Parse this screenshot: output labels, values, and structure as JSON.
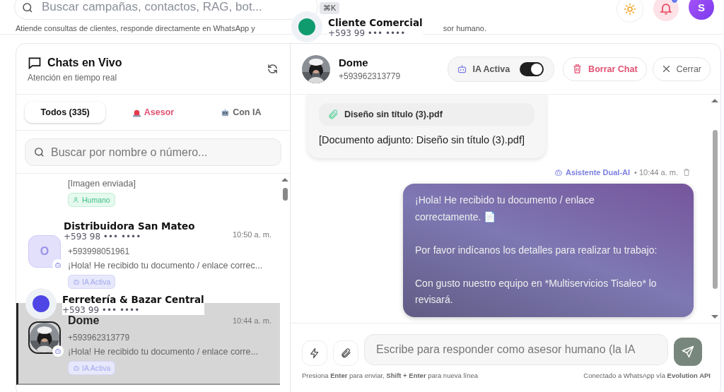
{
  "topbar": {
    "search_placeholder": "Buscar campañas, contactos, RAG, bot...",
    "shortcut": "⌘K",
    "avatar_initial": "S",
    "notifications_unread": true
  },
  "page_subtitle": [
    "Atiende consultas de clientes, responde directamente en WhatsApp y",
    "sor humano."
  ],
  "chats_panel": {
    "title": "Chats en Vivo",
    "subtitle": "Atención en tiempo real",
    "tabs": [
      {
        "label": "Todos (335)",
        "selected": true,
        "kind": "all"
      },
      {
        "label": "Asesor",
        "selected": false,
        "kind": "advisor"
      },
      {
        "label": "Con IA",
        "selected": false,
        "kind": "ai"
      }
    ],
    "search_placeholder": "Buscar por nombre o número...",
    "conversations": [
      {
        "kind": "partial",
        "preview": "[Imagen enviada]",
        "tag": {
          "kind": "human",
          "label": "Humano"
        },
        "selected": false
      },
      {
        "kind": "initial",
        "avatar_initial": "O",
        "time": "10:50 a. m.",
        "phone": "+593998051961",
        "preview": "¡Hola! He recibido tu documento / enlace correc...",
        "tag": {
          "kind": "ai",
          "label": "IA Activa"
        },
        "selected": false
      },
      {
        "name": "Dome",
        "time": "10:44 a. m.",
        "phone": "+593962313779",
        "preview": "¡Hola! He recibido tu documento / enlace corre...",
        "tag": {
          "kind": "ai",
          "label": "IA Activa"
        },
        "selected": true
      }
    ]
  },
  "chat": {
    "contact_name": "Dome",
    "contact_phone": "+593962313779",
    "ai_toggle": {
      "label": "IA Activa",
      "on": true
    },
    "delete_label": "Borrar Chat",
    "close_label": "Cerrar",
    "messages": [
      {
        "kind": "incoming",
        "attachment": "Diseño sin título (3).pdf",
        "text": "[Documento adjunto: Diseño sin título (3).pdf]"
      },
      {
        "kind": "outgoing",
        "sender": "Asistente Dual-AI",
        "time": "• 10:44 a. m.",
        "text": "¡Hola! He recibido tu documento / enlace\ncorrectamente. 📄\n\nPor favor indícanos los detalles para realizar tu trabajo:\n\nCon gusto nuestro equipo en *Multiservicios Tisaleo* lo revisará."
      }
    ],
    "composer_placeholder": "Escribe para responder como asesor humano (la IA",
    "hint": "Presiona **Enter** para enviar, **Shift + Enter** para nueva línea",
    "connection": "Conectado a WhatsApp vía **Evolution API**"
  },
  "pins": [
    {
      "kind": "dot",
      "name": "Cliente Comercial",
      "phone": "+593 99 ••• ••••",
      "color": "#0f9b6e"
    },
    {
      "kind": "label",
      "name": "Distribuidora San Mateo",
      "phone": "+593 98 ••• ••••"
    },
    {
      "kind": "dot",
      "name": "Ferretería & Bazar Central",
      "phone": "+593 99 ••• ••••",
      "color": "#4f46e5"
    }
  ]
}
